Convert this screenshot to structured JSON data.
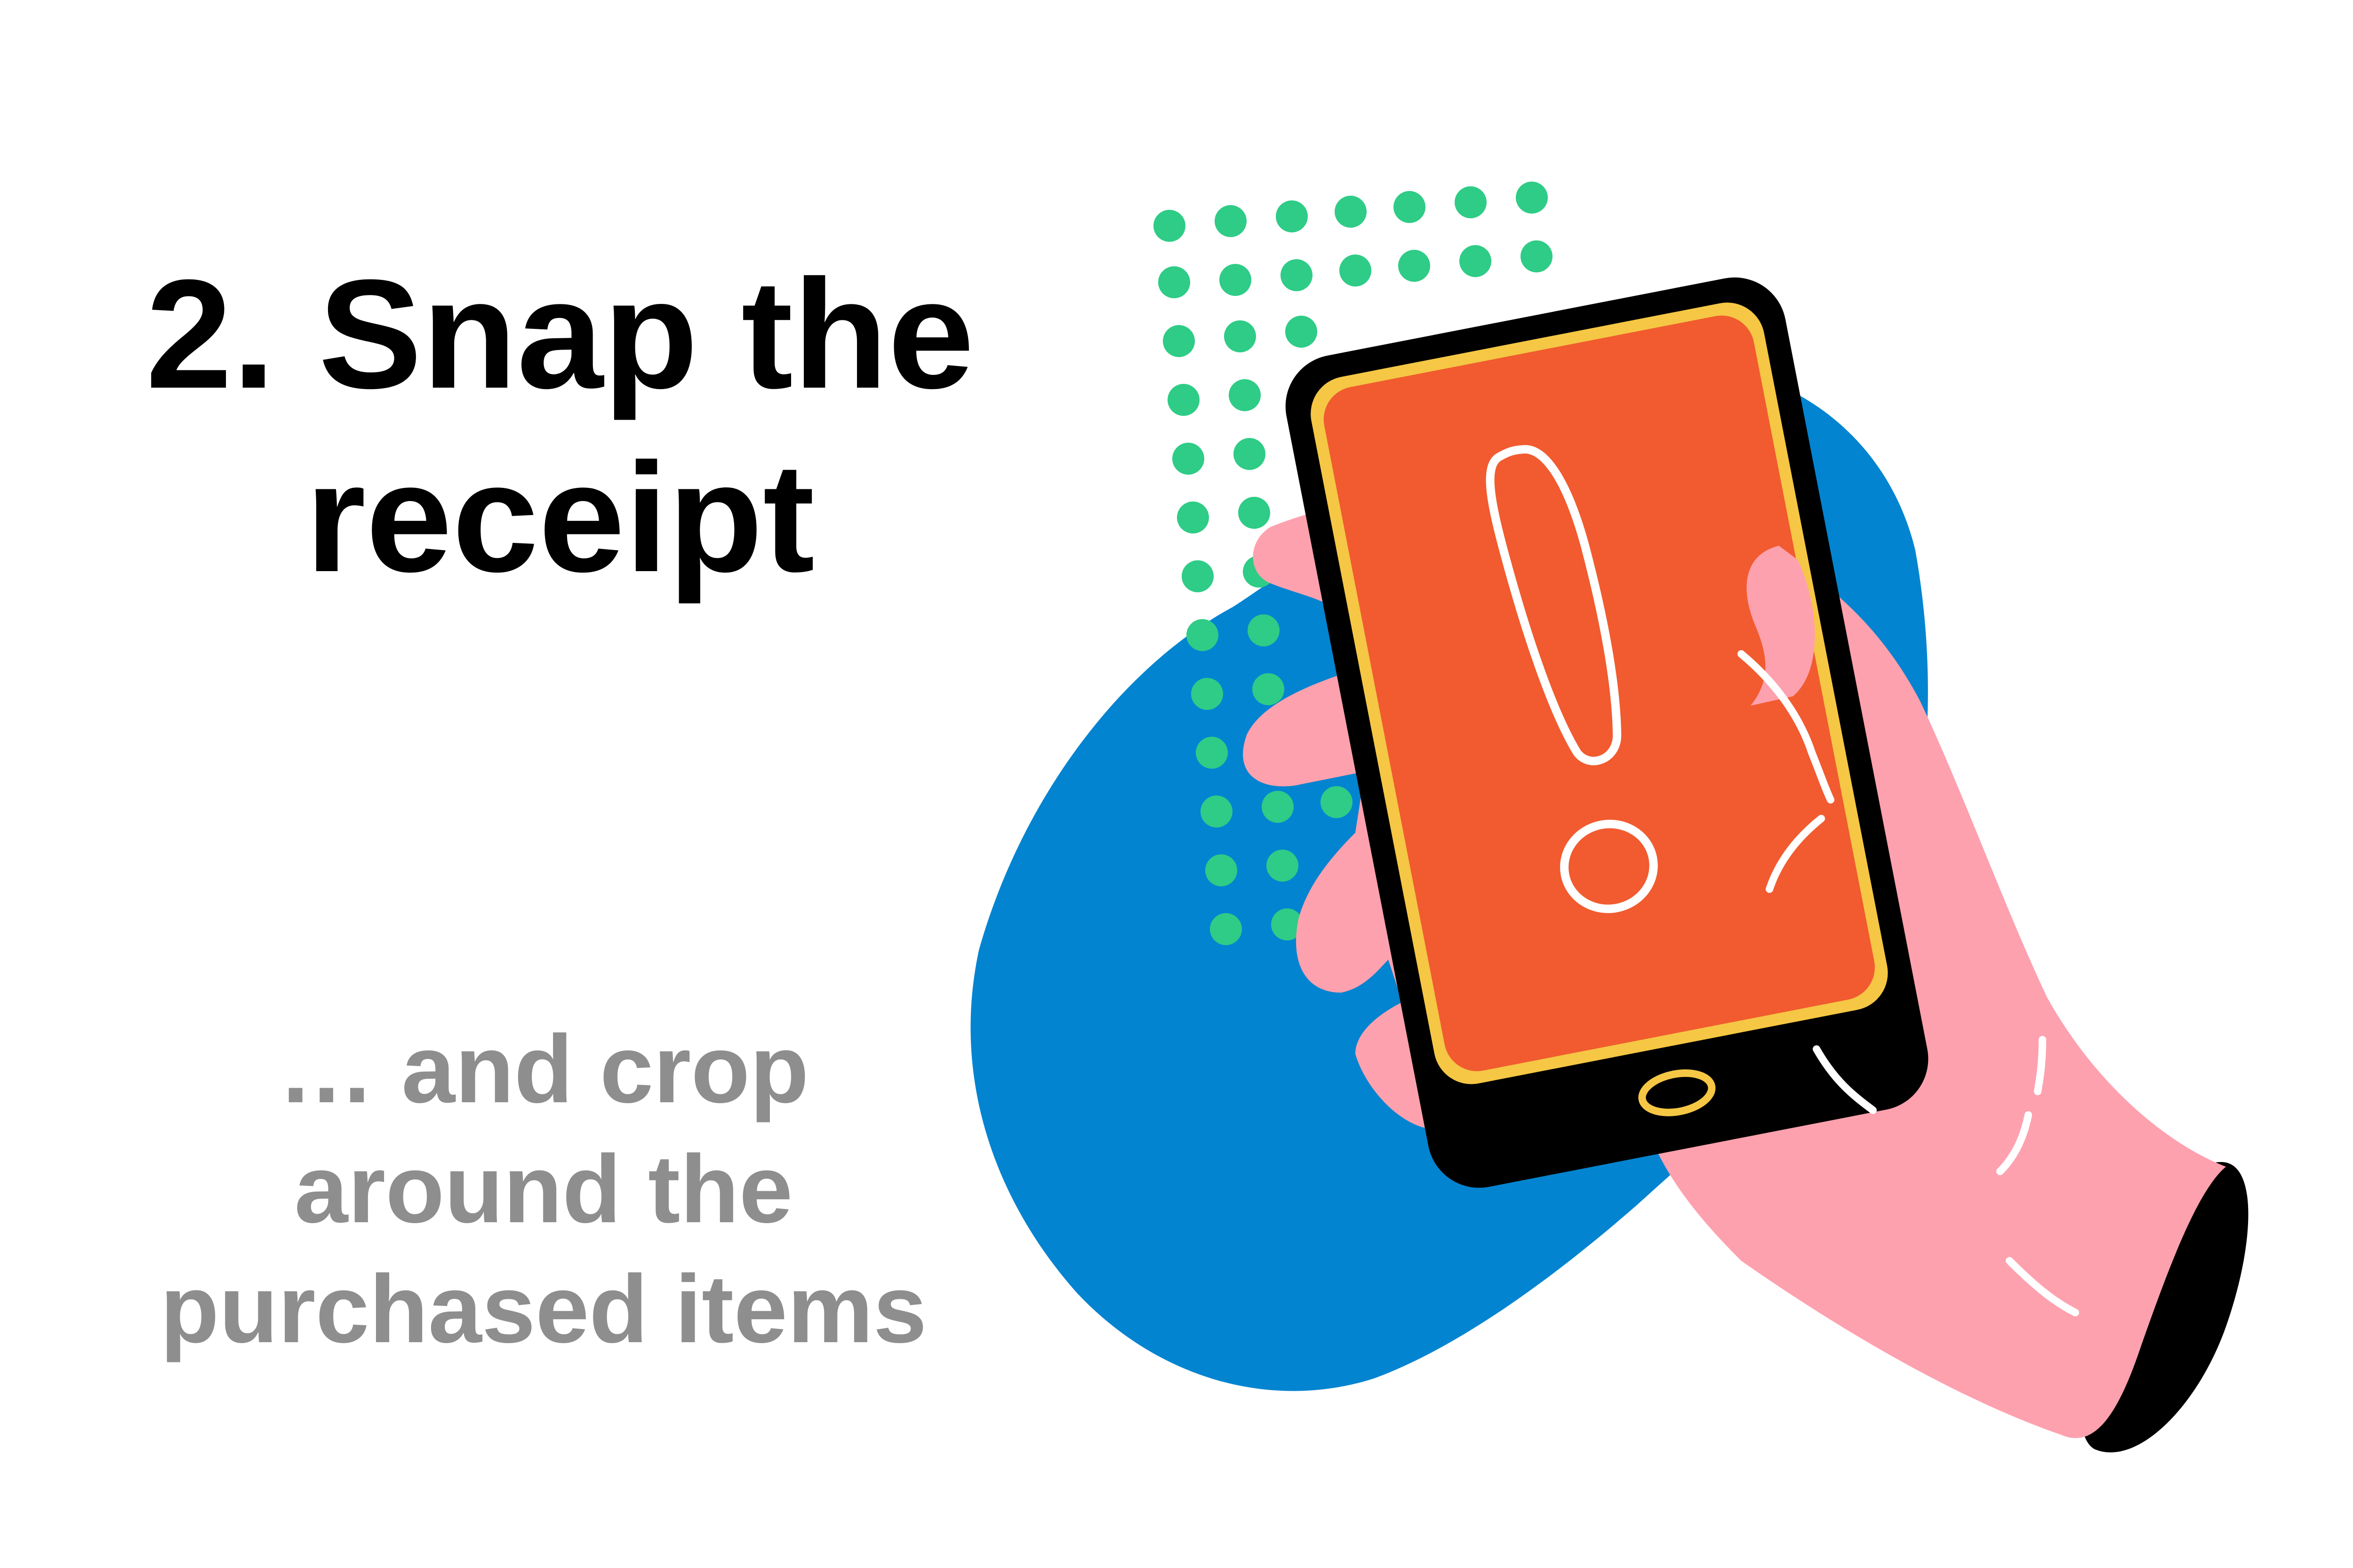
{
  "headline": {
    "line1": "2. Snap the",
    "line2": "receipt"
  },
  "subheadline": {
    "line1": "… and crop",
    "line2": "around the",
    "line3": "purchased items"
  },
  "illustration": {
    "icon": "hand-holding-phone-alert-icon",
    "colors": {
      "blob": "#0384d0",
      "dots": "#2ecc86",
      "hand": "#fea1ae",
      "phone_body": "#000000",
      "phone_screen": "#f15b2f",
      "screen_border": "#f5c744",
      "exclamation": "#ffffff"
    }
  }
}
